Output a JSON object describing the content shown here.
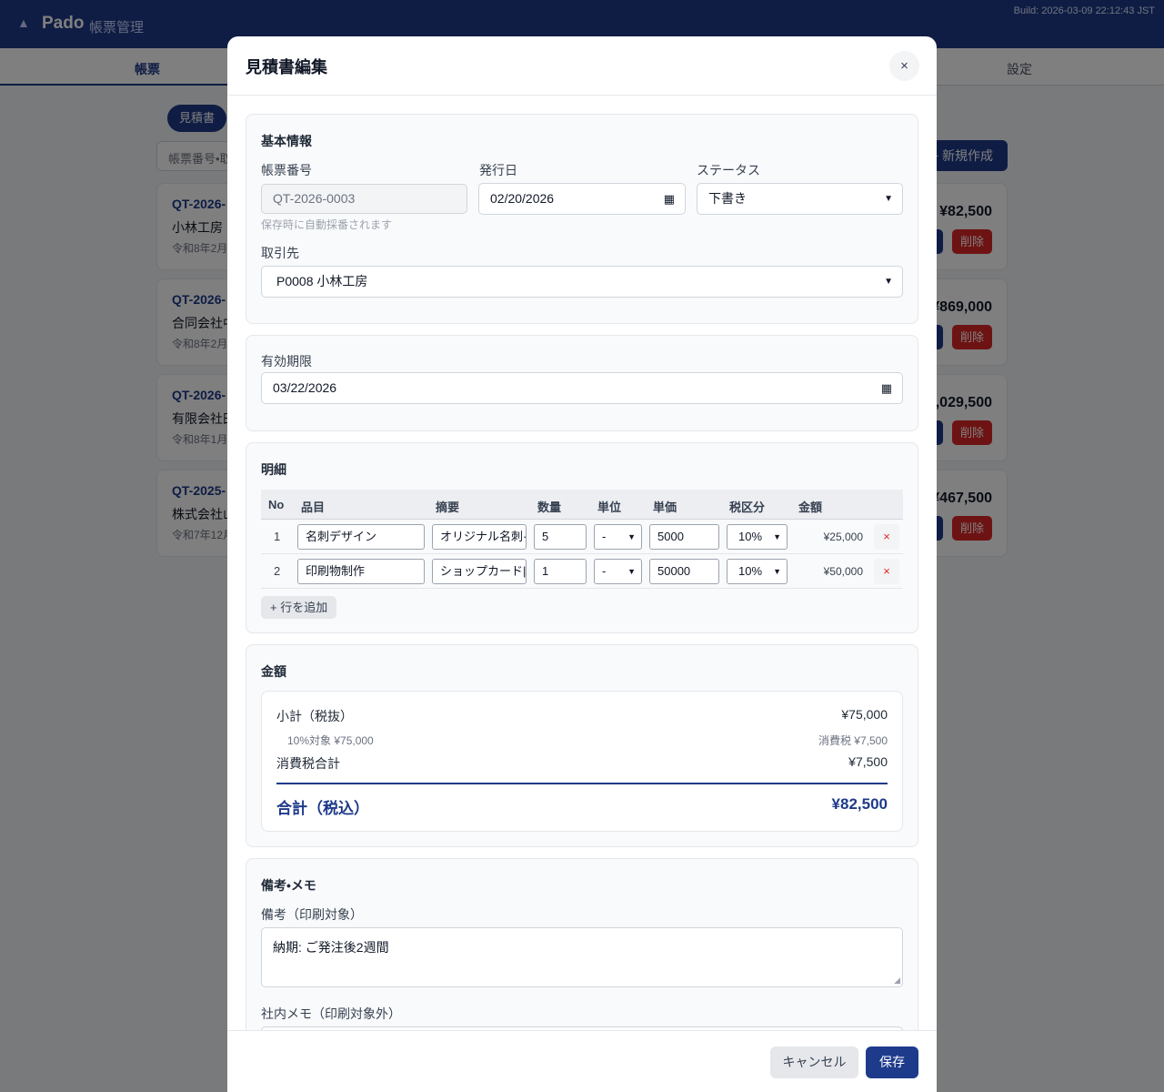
{
  "app": {
    "name": "Pado",
    "subtitle": "帳票管理",
    "build": "Build: 2026-03-09 22:12:43 JST"
  },
  "nav": {
    "active_tab": "帳票",
    "settings_tab": "設定"
  },
  "background": {
    "filter_chip": "見積書",
    "search_placeholder": "帳票番号•取",
    "new_button": "+ 新規作成",
    "cards": [
      {
        "no": "QT-2026-",
        "client": "小林工房",
        "date": "令和8年2月",
        "amount": "¥82,500",
        "delete": "削除"
      },
      {
        "no": "QT-2026-",
        "client": "合同会社中",
        "date": "令和8年2月",
        "amount": "¥869,000",
        "delete": "削除"
      },
      {
        "no": "QT-2026-",
        "client": "有限会社田",
        "date": "令和8年1月",
        "amount": "¥1,029,500",
        "delete": "削除"
      },
      {
        "no": "QT-2025-",
        "client": "株式会社山",
        "date": "令和7年12月",
        "amount": "¥467,500",
        "delete": "削除"
      }
    ]
  },
  "modal": {
    "title": "見積書編集",
    "close": "×",
    "basic": {
      "title": "基本情報",
      "doc_no_label": "帳票番号",
      "doc_no_value": "QT-2026-0003",
      "doc_no_hint": "保存時に自動採番されます",
      "issue_date_label": "発行日",
      "issue_date_value": "02/20/2026",
      "status_label": "ステータス",
      "status_value": "下書き",
      "client_label": "取引先",
      "client_value": "P0008 小林工房"
    },
    "validity": {
      "label": "有効期限",
      "value": "03/22/2026"
    },
    "items": {
      "title": "明細",
      "headers": [
        "No",
        "品目",
        "摘要",
        "数量",
        "単位",
        "単価",
        "税区分",
        "金額"
      ],
      "rows": [
        {
          "no": "1",
          "item": "名刺デザイン",
          "summary": "オリジナル名刺·",
          "qty": "5",
          "unit": "-",
          "price": "5000",
          "tax": "10%",
          "amount": "¥25,000"
        },
        {
          "no": "2",
          "item": "印刷物制作",
          "summary": "ショップカード|",
          "qty": "1",
          "unit": "-",
          "price": "50000",
          "tax": "10%",
          "amount": "¥50,000"
        }
      ],
      "delete_icon": "×",
      "add_row": "+ 行を追加"
    },
    "totals": {
      "title": "金額",
      "subtotal_label": "小計（税抜）",
      "subtotal_value": "¥75,000",
      "taxable_label": "10%対象 ¥75,000",
      "taxable_tax": "消費税 ¥7,500",
      "tax_total_label": "消費税合計",
      "tax_total_value": "¥7,500",
      "grand_label": "合計（税込）",
      "grand_value": "¥82,500"
    },
    "notes": {
      "title": "備考•メモ",
      "print_label": "備考（印刷対象）",
      "print_value": "納期: ご発注後2週間",
      "internal_label": "社内メモ（印刷対象外）"
    },
    "footer": {
      "cancel": "キャンセル",
      "save": "保存"
    }
  },
  "colors": {
    "brand": "#1e3a8a",
    "danger": "#dc2626"
  }
}
